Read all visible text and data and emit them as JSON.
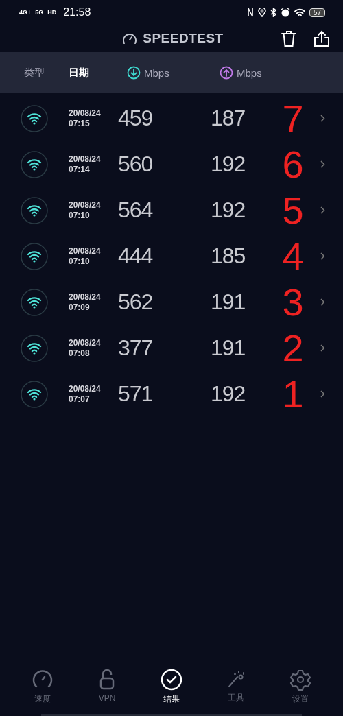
{
  "status_bar": {
    "network_labels": [
      "4G+",
      "5G",
      "HD"
    ],
    "time": "21:58",
    "battery": "57"
  },
  "header": {
    "title": "SPEEDTEST"
  },
  "columns": [
    {
      "label": "类型",
      "selected": false,
      "kind": "text"
    },
    {
      "label": "日期",
      "selected": true,
      "kind": "text"
    },
    {
      "label": "Mbps",
      "selected": false,
      "kind": "download"
    },
    {
      "label": "Mbps",
      "selected": false,
      "kind": "upload"
    }
  ],
  "results": [
    {
      "date": "20/08/24",
      "time": "07:15",
      "download": "459",
      "upload": "187",
      "annotation": "7"
    },
    {
      "date": "20/08/24",
      "time": "07:14",
      "download": "560",
      "upload": "192",
      "annotation": "6"
    },
    {
      "date": "20/08/24",
      "time": "07:10",
      "download": "564",
      "upload": "192",
      "annotation": "5"
    },
    {
      "date": "20/08/24",
      "time": "07:10",
      "download": "444",
      "upload": "185",
      "annotation": "4"
    },
    {
      "date": "20/08/24",
      "time": "07:09",
      "download": "562",
      "upload": "191",
      "annotation": "3"
    },
    {
      "date": "20/08/24",
      "time": "07:08",
      "download": "377",
      "upload": "191",
      "annotation": "2"
    },
    {
      "date": "20/08/24",
      "time": "07:07",
      "download": "571",
      "upload": "192",
      "annotation": "1"
    }
  ],
  "nav": [
    {
      "label": "速度",
      "kind": "speed",
      "selected": false
    },
    {
      "label": "VPN",
      "kind": "vpn",
      "selected": false
    },
    {
      "label": "结果",
      "kind": "results",
      "selected": true
    },
    {
      "label": "工具",
      "kind": "tools",
      "selected": false
    },
    {
      "label": "设置",
      "kind": "settings",
      "selected": false
    }
  ]
}
